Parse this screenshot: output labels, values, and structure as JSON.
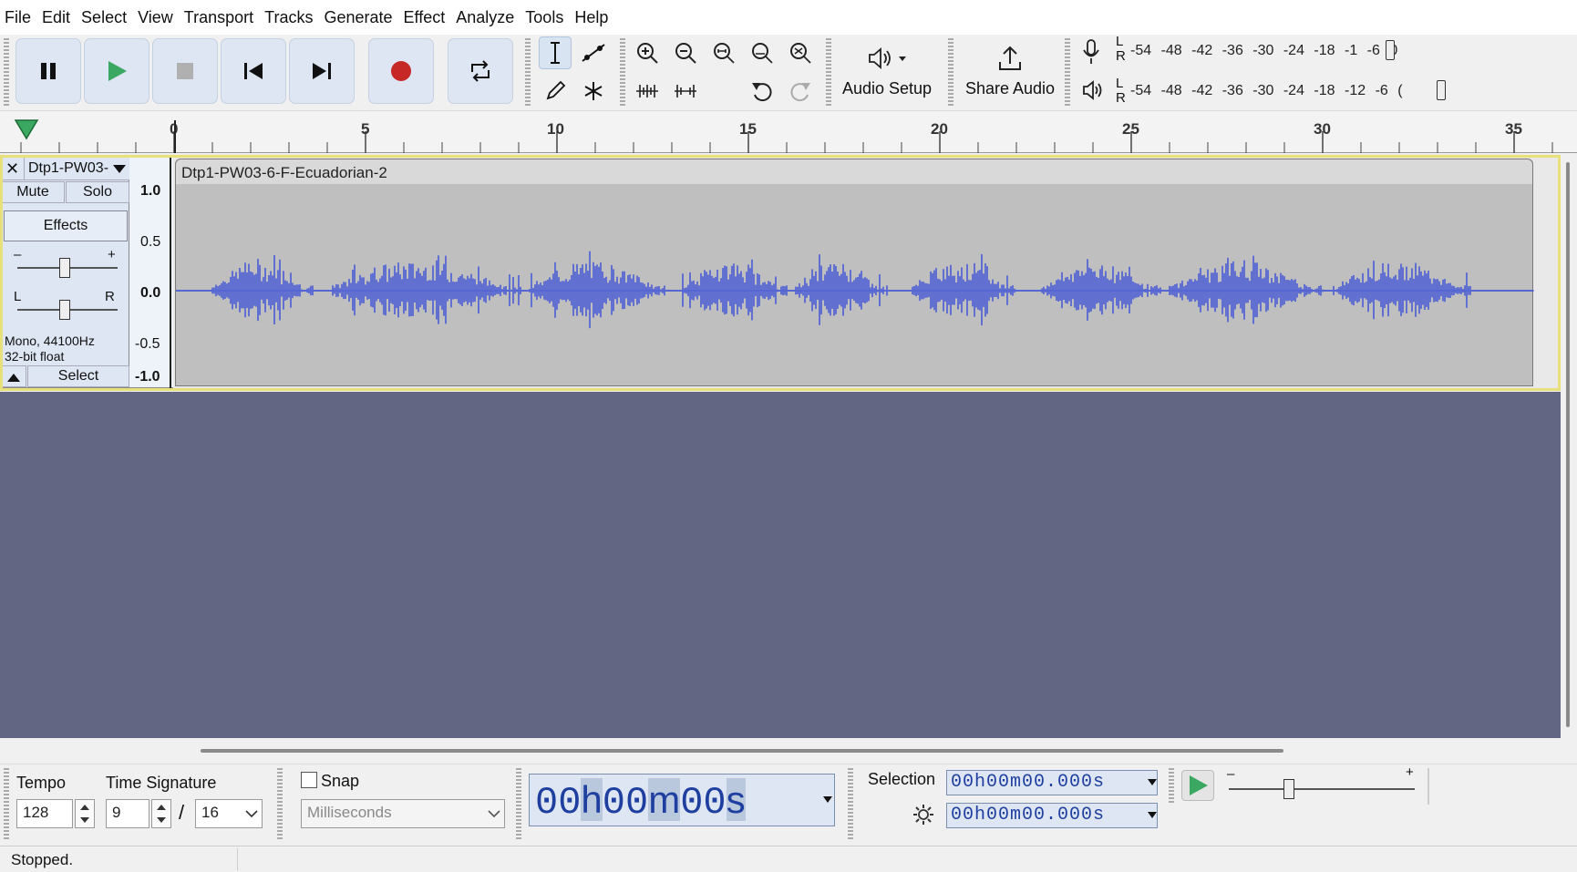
{
  "menu": [
    "File",
    "Edit",
    "Select",
    "View",
    "Transport",
    "Tracks",
    "Generate",
    "Effect",
    "Analyze",
    "Tools",
    "Help"
  ],
  "toolbar": {
    "audio_setup_label": "Audio Setup",
    "share_audio_label": "Share Audio"
  },
  "meters": {
    "record_ticks": "-54 -48 -42 -36 -30 -24 -18 -1  -6  0",
    "playback_ticks": "-54 -48 -42 -36 -30 -24 -18 -12  -6  (",
    "lr_top": "L",
    "lr_bottom": "R"
  },
  "ruler": {
    "labels": [
      "0",
      "5",
      "10",
      "15",
      "20",
      "25",
      "30",
      "35"
    ]
  },
  "track": {
    "name": "Dtp1-PW03-",
    "clip_name": "Dtp1-PW03-6-F-Ecuadorian-2",
    "mute_label": "Mute",
    "solo_label": "Solo",
    "effects_label": "Effects",
    "gain_minus": "–",
    "gain_plus": "+",
    "pan_left": "L",
    "pan_right": "R",
    "format_line1": "Mono, 44100Hz",
    "format_line2": "32-bit float",
    "select_label": "Select",
    "scale": [
      "1.0",
      "0.5",
      "0.0",
      "-0.5",
      "-1.0"
    ],
    "waveform_color": "#4a5cd4"
  },
  "bottom": {
    "tempo_label": "Tempo",
    "tempo_value": "128",
    "time_signature_label": "Time Signature",
    "ts_numerator": "9",
    "ts_slash": "/",
    "ts_denominator": "16",
    "snap_label": "Snap",
    "snap_unit": "Milliseconds",
    "time_display": [
      "00",
      "h",
      "00",
      "m",
      "00",
      "s"
    ],
    "selection_label": "Selection",
    "selection_start": "00h00m00.000s",
    "selection_end": "00h00m00.000s",
    "speed_minus": "–",
    "speed_plus": "+"
  },
  "status": {
    "text": "Stopped."
  },
  "colors": {
    "accent": "#dde6f2",
    "play_green": "#3aa860",
    "record_red": "#c62828",
    "track_bg": "#bfbfbf",
    "empty_bg": "#626683",
    "selected_border": "#e8e07a"
  }
}
